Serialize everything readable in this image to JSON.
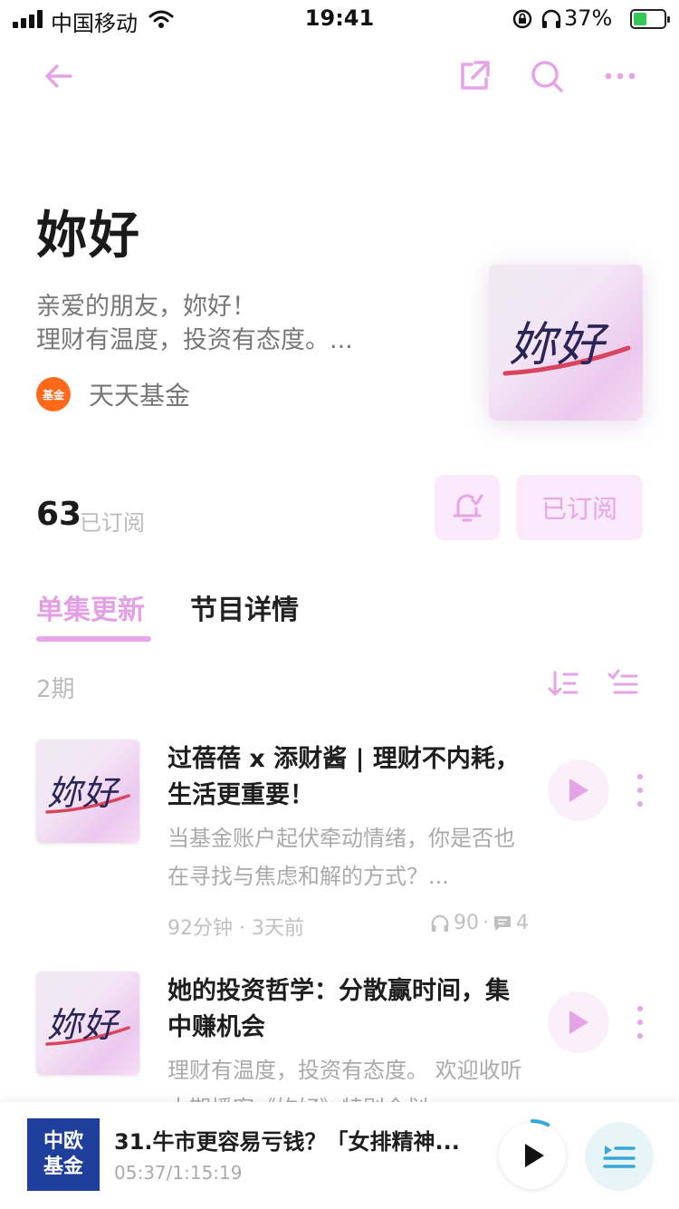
{
  "status_bar": {
    "carrier": "中国移动",
    "time": "19:41",
    "battery": "37%"
  },
  "nav": {
    "back_icon": "back-arrow-icon",
    "share_icon": "share-icon",
    "search_icon": "search-icon",
    "more_icon": "more-icon"
  },
  "podcast": {
    "title": "妳好",
    "description_line1": "亲爱的朋友，妳好！",
    "description_line2": "理财有温度，投资有态度。...",
    "author": "天天基金",
    "author_logo_text": "基金",
    "cover_text": "妳好"
  },
  "subscription": {
    "count": "63",
    "label": "已订阅",
    "button_label": "已订阅"
  },
  "tabs": [
    {
      "label": "单集更新",
      "active": true
    },
    {
      "label": "节目详情",
      "active": false
    }
  ],
  "episode_count": "2期",
  "episodes": [
    {
      "cover_text": "妳好",
      "title": "过蓓蓓 x 添财酱 | 理财不内耗，生活更重要！",
      "description": "当基金账户起伏牵动情绪，你是否也在寻找与焦虑和解的方式？...",
      "duration": "92分钟",
      "published": "3天前",
      "listens": "90",
      "comments": "4"
    },
    {
      "cover_text": "妳好",
      "title": "她的投资哲学：分散赢时间，集中赚机会",
      "description": "理财有温度，投资有态度。 欢迎收听本期播客《妳好》特别企划"
    }
  ],
  "player": {
    "cover_text_line1": "中欧",
    "cover_text_line2": "基金",
    "title": "31.牛市更容易亏钱？「女排精神...",
    "time": "05:37/1:15:19",
    "progress": 0.075
  },
  "colors": {
    "accent": "#e6a4e6",
    "accent_bg": "#fbeafb",
    "author_logo": "#ff6a1a",
    "player_cover": "#1f3f9c"
  }
}
